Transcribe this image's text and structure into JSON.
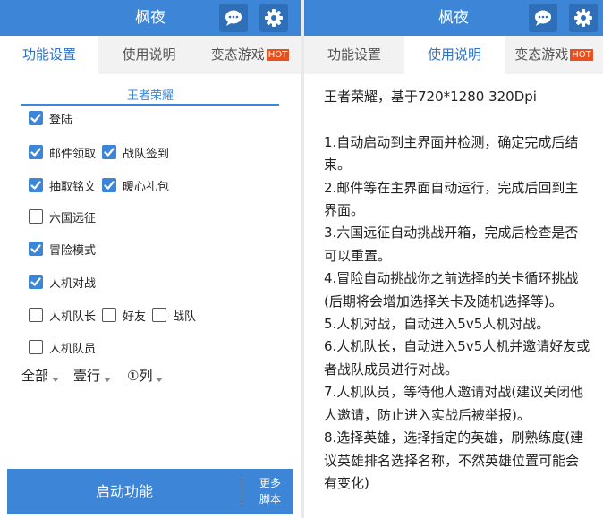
{
  "app": {
    "title": "枫夜"
  },
  "tabs": [
    "功能设置",
    "使用说明",
    "变态游戏"
  ],
  "hot_badge": "HOT",
  "icons": {
    "chat": "chat-bubble-icon",
    "settings": "gear-icon"
  },
  "colors": {
    "primary": "#3d85d6",
    "hot": "#e8501f"
  },
  "settings": {
    "section_title": "王者荣耀",
    "options": [
      {
        "label": "登陆",
        "checked": true
      },
      {
        "label": "邮件领取",
        "checked": true
      },
      {
        "label": "战队签到",
        "checked": true
      },
      {
        "label": "抽取铭文",
        "checked": true
      },
      {
        "label": "暖心礼包",
        "checked": true
      },
      {
        "label": "六国远征",
        "checked": false
      },
      {
        "label": "冒险模式",
        "checked": true
      },
      {
        "label": "人机对战",
        "checked": true
      },
      {
        "label": "人机队长",
        "checked": false
      },
      {
        "label": "好友",
        "checked": false
      },
      {
        "label": "战队",
        "checked": false
      },
      {
        "label": "人机队员",
        "checked": false
      }
    ],
    "selects": [
      "全部",
      "壹行",
      "①列"
    ]
  },
  "start": {
    "label": "启动功能",
    "more_line1": "更多",
    "more_line2": "脚本"
  },
  "instructions": "王者荣耀，基于720*1280 320Dpi\n\n1.自动启动到主界面并检测，确定完成后结束。\n2.邮件等在主界面自动运行，完成后回到主界面。\n3.六国远征自动挑战开箱，完成后检查是否可以重置。\n4.冒险自动挑战你之前选择的关卡循环挑战(后期将会增加选择关卡及随机选择等)。\n5.人机对战，自动进入5v5人机对战。\n6.人机队长，自动进入5v5人机并邀请好友或者战队成员进行对战。\n7.人机队员，等待他人邀请对战(建议关闭他人邀请，防止进入实战后被举报)。\n8.选择英雄，选择指定的英雄，刷熟练度(建议英雄排名选择名称，不然英雄位置可能会有变化)"
}
